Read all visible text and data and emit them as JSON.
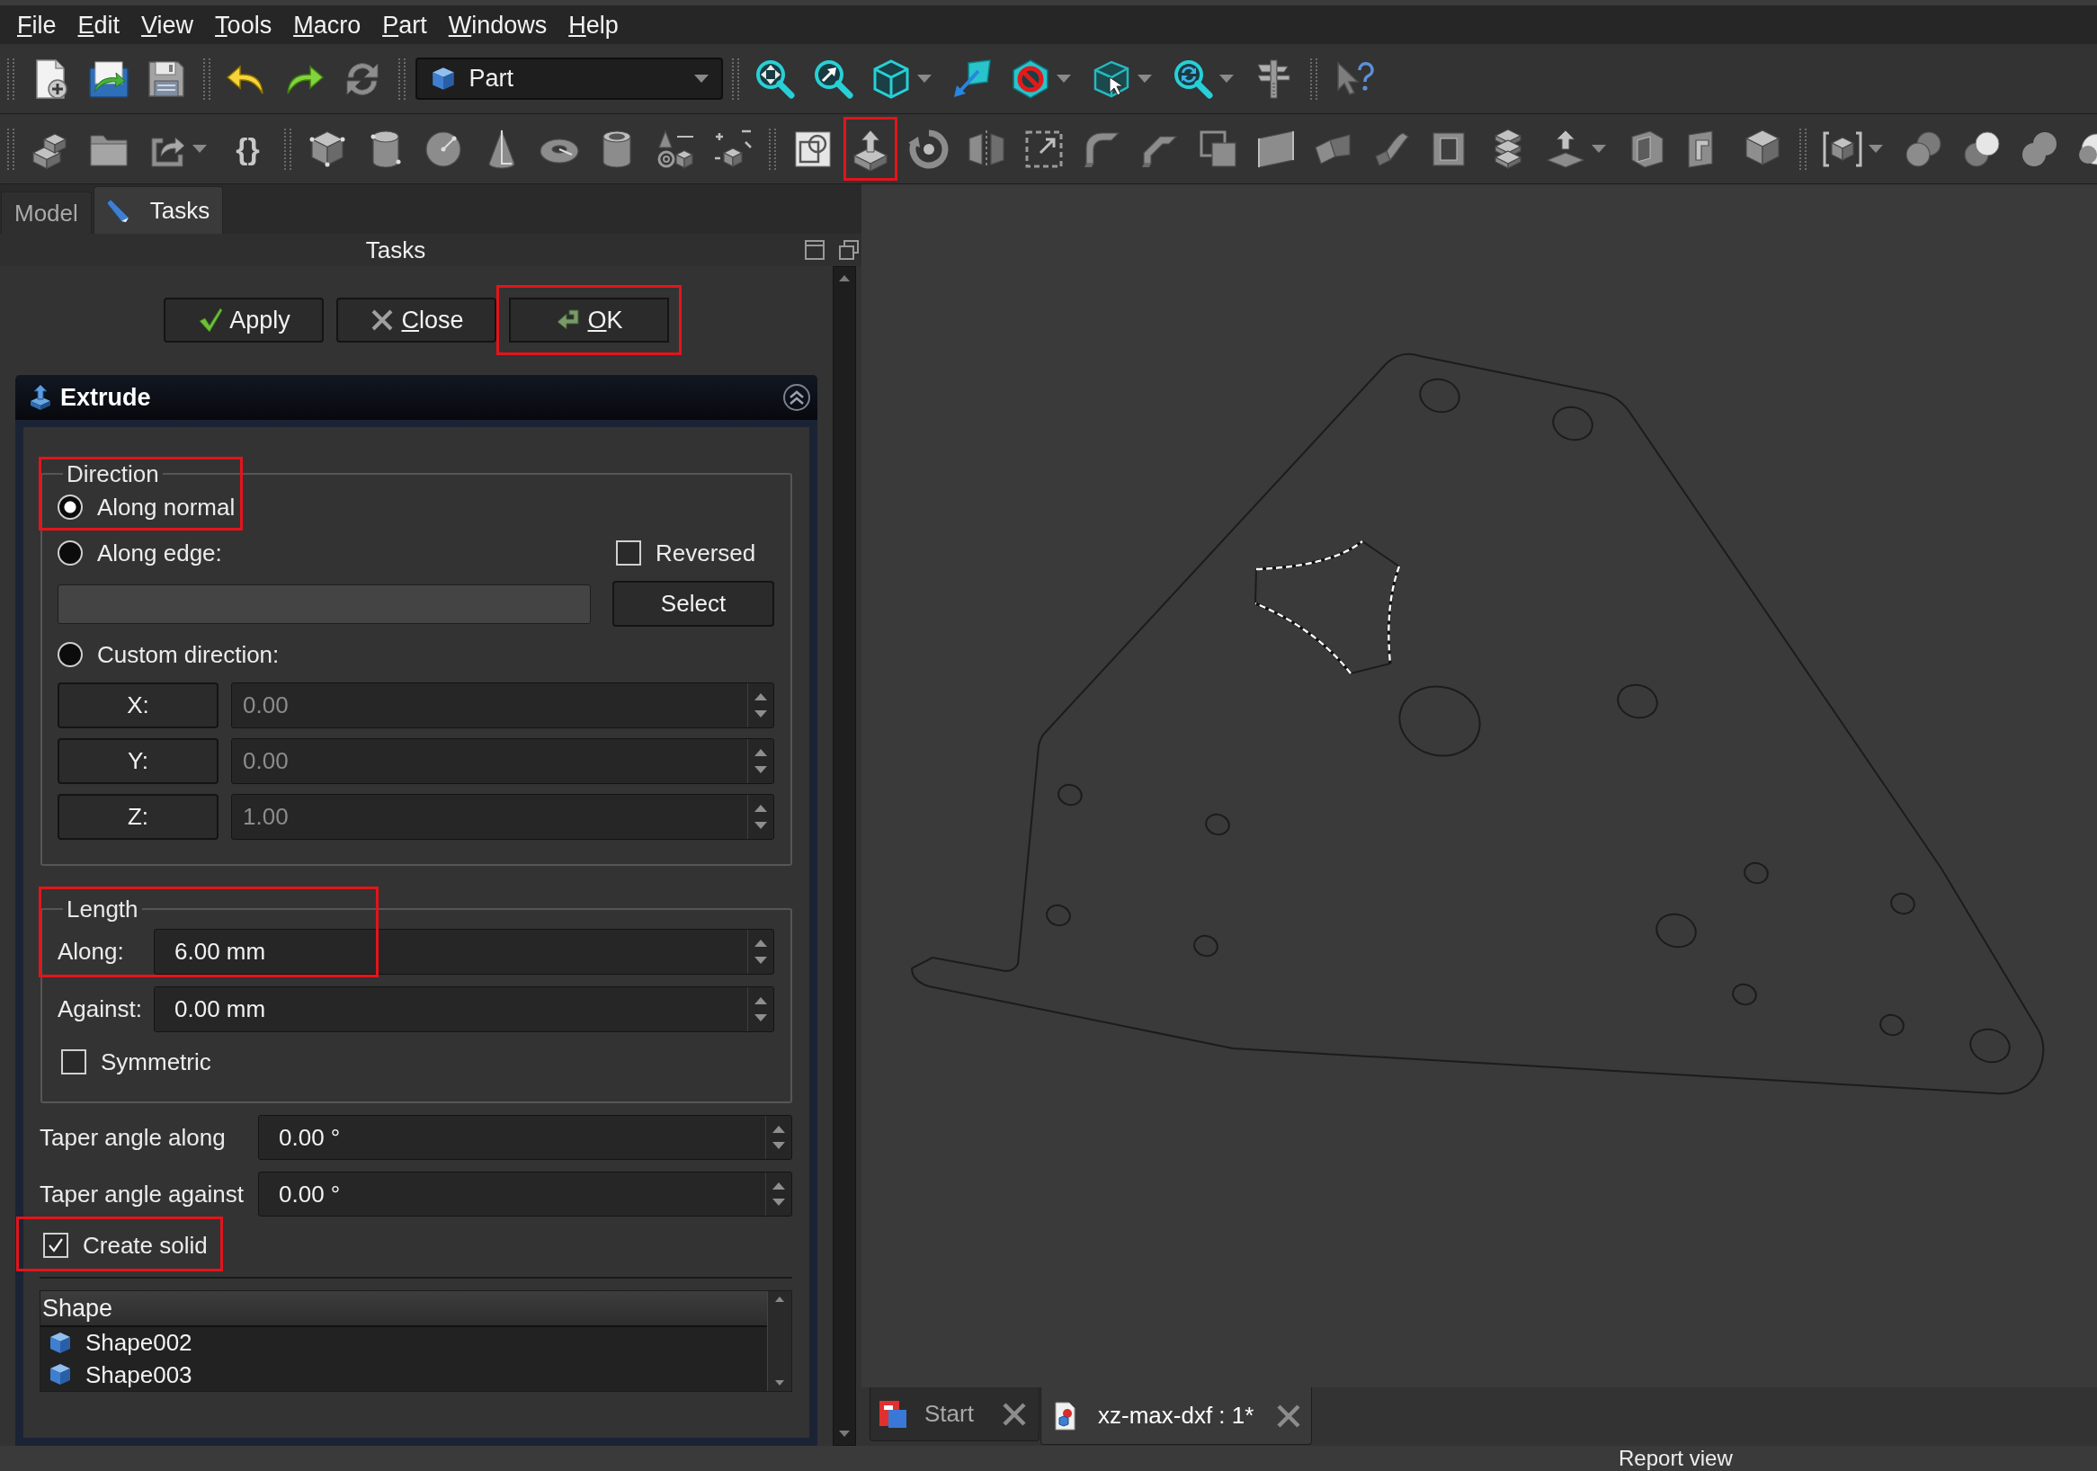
{
  "menu_bar": [
    {
      "label": "File"
    },
    {
      "label": "Edit"
    },
    {
      "label": "View"
    },
    {
      "label": "Tools"
    },
    {
      "label": "Macro"
    },
    {
      "label": "Part"
    },
    {
      "label": "Windows"
    },
    {
      "label": "Help"
    }
  ],
  "toolbars": [
    {
      "items": [
        {
          "kind": "separator"
        },
        {
          "kind": "button",
          "highlighted": false
        },
        {
          "kind": "button",
          "highlighted": false
        },
        {
          "kind": "button",
          "highlighted": false
        },
        {
          "kind": "separator"
        },
        {
          "kind": "button",
          "highlighted": false
        },
        {
          "kind": "button",
          "highlighted": false
        },
        {
          "kind": "button",
          "highlighted": false
        },
        {
          "kind": "separator"
        },
        {
          "kind": "selector",
          "label": "Part",
          "highlighted": false
        },
        {
          "kind": "separator"
        },
        {
          "kind": "button",
          "highlighted": false
        },
        {
          "kind": "button",
          "highlighted": false
        },
        {
          "kind": "dropdown",
          "highlighted": false
        },
        {
          "kind": "button",
          "highlighted": false
        },
        {
          "kind": "dropdown",
          "highlighted": false
        },
        {
          "kind": "dropdown",
          "highlighted": false
        },
        {
          "kind": "dropdown",
          "highlighted": false
        },
        {
          "kind": "button",
          "highlighted": false
        },
        {
          "kind": "separator"
        },
        {
          "kind": "button",
          "highlighted": false
        }
      ]
    },
    {
      "items": [
        {
          "kind": "separator"
        },
        {
          "kind": "button",
          "highlighted": false
        },
        {
          "kind": "button",
          "highlighted": false
        },
        {
          "kind": "dropdown",
          "highlighted": false
        },
        {
          "kind": "glyph",
          "label": "{}",
          "highlighted": false
        },
        {
          "kind": "separator"
        },
        {
          "kind": "button",
          "highlighted": false
        },
        {
          "kind": "button",
          "highlighted": false
        },
        {
          "kind": "button",
          "highlighted": false
        },
        {
          "kind": "button",
          "highlighted": false
        },
        {
          "kind": "button",
          "highlighted": false
        },
        {
          "kind": "button",
          "highlighted": false
        },
        {
          "kind": "button",
          "highlighted": false
        },
        {
          "kind": "button",
          "highlighted": false
        },
        {
          "kind": "separator"
        },
        {
          "kind": "button",
          "highlighted": false
        },
        {
          "kind": "button",
          "highlighted": true
        },
        {
          "kind": "button",
          "highlighted": false
        },
        {
          "kind": "button",
          "highlighted": false
        },
        {
          "kind": "button",
          "highlighted": false
        },
        {
          "kind": "button",
          "highlighted": false
        },
        {
          "kind": "button",
          "highlighted": false
        },
        {
          "kind": "button",
          "highlighted": false
        },
        {
          "kind": "button",
          "highlighted": false
        },
        {
          "kind": "button",
          "highlighted": false
        },
        {
          "kind": "button",
          "highlighted": false
        },
        {
          "kind": "button",
          "highlighted": false
        },
        {
          "kind": "button",
          "highlighted": false
        },
        {
          "kind": "dropdown",
          "highlighted": false
        },
        {
          "kind": "button",
          "highlighted": false
        },
        {
          "kind": "button",
          "highlighted": false
        },
        {
          "kind": "button",
          "highlighted": false
        },
        {
          "kind": "separator"
        },
        {
          "kind": "dropdown",
          "highlighted": false
        },
        {
          "kind": "button",
          "highlighted": false
        },
        {
          "kind": "button",
          "highlighted": false
        },
        {
          "kind": "button",
          "highlighted": false
        },
        {
          "kind": "button",
          "highlighted": false
        }
      ]
    }
  ],
  "side_tabs": [
    {
      "label": "Model",
      "selected": false
    },
    {
      "label": "Tasks",
      "selected": true
    }
  ],
  "task_panel": {
    "title": "Tasks",
    "buttons": [
      {
        "label": "Apply",
        "kind": "apply",
        "mnemonic": false,
        "highlighted": false
      },
      {
        "label": "Close",
        "kind": "close",
        "mnemonic": true,
        "highlighted": false
      },
      {
        "label": "OK",
        "kind": "ok",
        "mnemonic": true,
        "highlighted": true
      }
    ],
    "extrude": {
      "title": "Extrude",
      "direction": {
        "title": "Direction",
        "options": [
          {
            "label": "Along normal",
            "selected": true,
            "highlighted": true
          },
          {
            "label": "Along edge:",
            "selected": false,
            "highlighted": false
          },
          {
            "label": "Custom direction:",
            "selected": false,
            "highlighted": false
          }
        ],
        "reversed": {
          "label": "Reversed",
          "checked": false
        },
        "edge_field": {
          "disabled": true
        },
        "select_button": {
          "label": "Select"
        },
        "components": [
          {
            "label": "X:",
            "value": "0.00",
            "disabled": true
          },
          {
            "label": "Y:",
            "value": "0.00",
            "disabled": true
          },
          {
            "label": "Z:",
            "value": "1.00",
            "disabled": true
          }
        ]
      },
      "length": {
        "title": "Length",
        "highlighted": true,
        "fields": [
          {
            "label": "Along:",
            "value": "6.00 mm",
            "disabled": false
          },
          {
            "label": "Against:",
            "value": "0.00 mm",
            "disabled": false
          }
        ],
        "symmetric": {
          "label": "Symmetric",
          "checked": false
        }
      },
      "taper": [
        {
          "label": "Taper angle along",
          "value": "0.00 °"
        },
        {
          "label": "Taper angle against",
          "value": "0.00 °"
        }
      ],
      "create_solid": {
        "label": "Create solid",
        "checked": true,
        "highlighted": true
      },
      "shape_list": {
        "header": "Shape",
        "items": [
          {
            "label": "Shape002",
            "selected": false
          },
          {
            "label": "Shape003",
            "selected": false
          }
        ]
      }
    }
  },
  "document_tabs": [
    {
      "label": "Start",
      "kind": "start",
      "selected": false
    },
    {
      "label": "xz-max-dxf : 1*",
      "kind": "document",
      "selected": true
    }
  ],
  "report_view": {
    "title": "Report view"
  }
}
